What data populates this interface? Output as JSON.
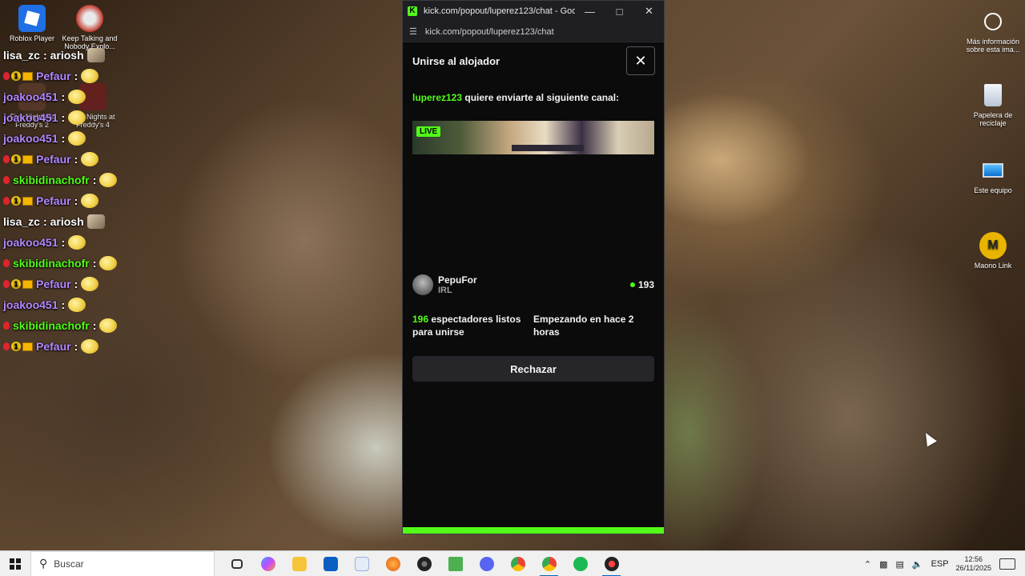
{
  "desktop": {
    "icons_left": [
      {
        "label": "Roblox Player"
      },
      {
        "label": "Keep Talking and Nobody Explo..."
      },
      {
        "label": "Five Nights at Freddy's 2"
      },
      {
        "label": "Five Nights at Freddy's 4"
      }
    ],
    "icons_right": [
      {
        "label": "Más información sobre esta ima..."
      },
      {
        "label": "Papelera de reciclaje"
      },
      {
        "label": "Este equipo"
      },
      {
        "label": "Maono Link"
      }
    ]
  },
  "chat": {
    "messages": [
      {
        "user": "lisa_zc",
        "color": "#ffffff",
        "badges": [],
        "emote": "cat"
      },
      {
        "user": "Pefaur",
        "color": "#b388ff",
        "badges": [
          "red",
          "gold",
          "box"
        ],
        "emote": "blob"
      },
      {
        "user": "joakoo451",
        "color": "#b388ff",
        "badges": [],
        "emote": "blob"
      },
      {
        "user": "joakoo451",
        "color": "#b388ff",
        "badges": [],
        "emote": "blob"
      },
      {
        "user": "joakoo451",
        "color": "#b388ff",
        "badges": [],
        "emote": "blob"
      },
      {
        "user": "Pefaur",
        "color": "#b388ff",
        "badges": [
          "red",
          "gold",
          "box"
        ],
        "emote": "blob"
      },
      {
        "user": "skibidinachofr",
        "color": "#53fc18",
        "badges": [
          "red"
        ],
        "emote": "blob"
      },
      {
        "user": "Pefaur",
        "color": "#b388ff",
        "badges": [
          "red",
          "gold",
          "box"
        ],
        "emote": "blob"
      },
      {
        "user": "lisa_zc",
        "color": "#ffffff",
        "badges": [],
        "emote": "cat"
      },
      {
        "user": "joakoo451",
        "color": "#b388ff",
        "badges": [],
        "emote": "blob"
      },
      {
        "user": "skibidinachofr",
        "color": "#53fc18",
        "badges": [
          "red"
        ],
        "emote": "blob"
      },
      {
        "user": "Pefaur",
        "color": "#b388ff",
        "badges": [
          "red",
          "gold",
          "box"
        ],
        "emote": "blob"
      },
      {
        "user": "joakoo451",
        "color": "#b388ff",
        "badges": [],
        "emote": "blob"
      },
      {
        "user": "skibidinachofr",
        "color": "#53fc18",
        "badges": [
          "red"
        ],
        "emote": "blob"
      },
      {
        "user": "Pefaur",
        "color": "#b388ff",
        "badges": [
          "red",
          "gold",
          "box"
        ],
        "emote": "blob"
      }
    ],
    "separator": ":",
    "lisa_text": "ariosh"
  },
  "window": {
    "title": "kick.com/popout/luperez123/chat - Google...",
    "url": "kick.com/popout/luperez123/chat",
    "panel_title": "Unirse al alojador",
    "host_name": "luperez123",
    "invite_text": "quiere enviarte al siguiente canal:",
    "live_label": "LIVE",
    "channel_name": "PepuFor",
    "channel_category": "IRL",
    "viewers": "193",
    "ready_count": "196",
    "ready_text": "espectadores listos para unirse",
    "starting_text": "Empezando en hace 2 horas",
    "reject_label": "Rechazar",
    "progress": 1.0
  },
  "taskbar": {
    "search_placeholder": "Buscar",
    "language": "ESP",
    "time": "12:56",
    "date": "26/11/2025"
  },
  "colors": {
    "kick_green": "#53fc18",
    "chat_purple": "#b388ff"
  }
}
